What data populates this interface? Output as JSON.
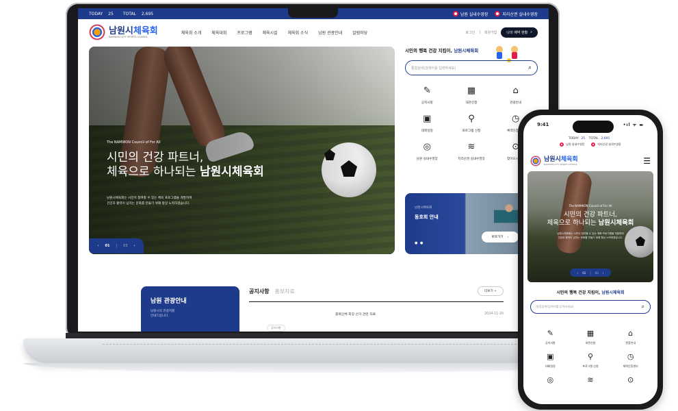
{
  "site": {
    "name_main": "남원시",
    "name_accent": "체육회",
    "name_en": "NAMWON CITY SPORTS COUNCIL"
  },
  "topstrip": {
    "today_label": "TODAY",
    "today_value": "25",
    "total_label": "TOTAL",
    "total_value": "2,695",
    "link1": "남원 실내수영장",
    "link2": "지리산권 실내수영장"
  },
  "gnb": [
    "체육회 소개",
    "체육대회",
    "프로그램",
    "체육시설",
    "체육회 소식",
    "남원 관광안내",
    "알림마당"
  ],
  "util": {
    "login": "로그인",
    "join": "회원가입",
    "reserve_btn": "나의 예약 현황"
  },
  "hero": {
    "eyebrow": "The NAMWON Council of For All",
    "title_line1": "시민의 건강 파트너,",
    "title_line2_pre": "체육으로 하나되는 ",
    "title_line2_bold": "남원시체육회",
    "desc_line1": "남원시체육회는 시민이 참여할 수 있는 체육 프로그램을 개발하여",
    "desc_line2": "건강과 활력이 넘치는 문화를 만들기 위해 항상 노력하겠습니다.",
    "pager_current": "01",
    "pager_total": "03",
    "prev": "‹",
    "next": "›"
  },
  "right_panel": {
    "title_pre": "시민의 행복 건강 지킴이, ",
    "title_accent": "남원시체육회",
    "search_placeholder": "통합검색(검색어를 입력하세요)"
  },
  "quick": [
    {
      "label": "공지사항",
      "icon": "notice-icon",
      "glyph": "📝"
    },
    {
      "label": "대관신청",
      "icon": "building-icon",
      "glyph": "🏟"
    },
    {
      "label": "관광안내",
      "icon": "tour-icon",
      "glyph": "🗺"
    },
    {
      "label": "대회일정",
      "icon": "calendar-icon",
      "glyph": "📅"
    },
    {
      "label": "프로그램 신청",
      "icon": "program-icon",
      "glyph": "🏸"
    },
    {
      "label": "체력인증센터",
      "icon": "fitness-icon",
      "glyph": "⏱"
    },
    {
      "label": "남원 실내수영장",
      "icon": "swim-icon",
      "glyph": "🏊"
    },
    {
      "label": "지리산권 실내수영장",
      "icon": "pool-icon",
      "glyph": "🌊"
    },
    {
      "label": "찾아오시는길",
      "icon": "map-icon",
      "glyph": "📍"
    }
  ],
  "promo": {
    "sub": "남원시체육회",
    "title": "동호회 안내",
    "go": "바로가기",
    "dots": "● ●"
  },
  "tour_card": {
    "title": "남원 관광안내",
    "desc_line1": "남원시의 관광지를",
    "desc_line2": "안내드립니다."
  },
  "news": {
    "tab_on": "공지사항",
    "tab_off": "홍보자료",
    "more": "더보기  +",
    "items": [
      {
        "badge": "공지사항",
        "title": "종목단체 회장 선거 관련 자료",
        "date": "2024-11-20"
      }
    ]
  },
  "phone": {
    "time": "9:41",
    "sys": "•ıl ᯤ ▬",
    "menu": "☰",
    "quick_labels_row1": [
      "공지사항",
      "대관신청",
      "관광안내"
    ],
    "quick_labels_row2": [
      "대회일정",
      "프로그램 신청",
      "체력인증센터"
    ],
    "quick_labels_row3": [
      "",
      "",
      ""
    ]
  },
  "colors": {
    "brand_navy": "#1e3a8a",
    "accent_blue": "#2563eb",
    "accent_red": "#e11d48"
  }
}
